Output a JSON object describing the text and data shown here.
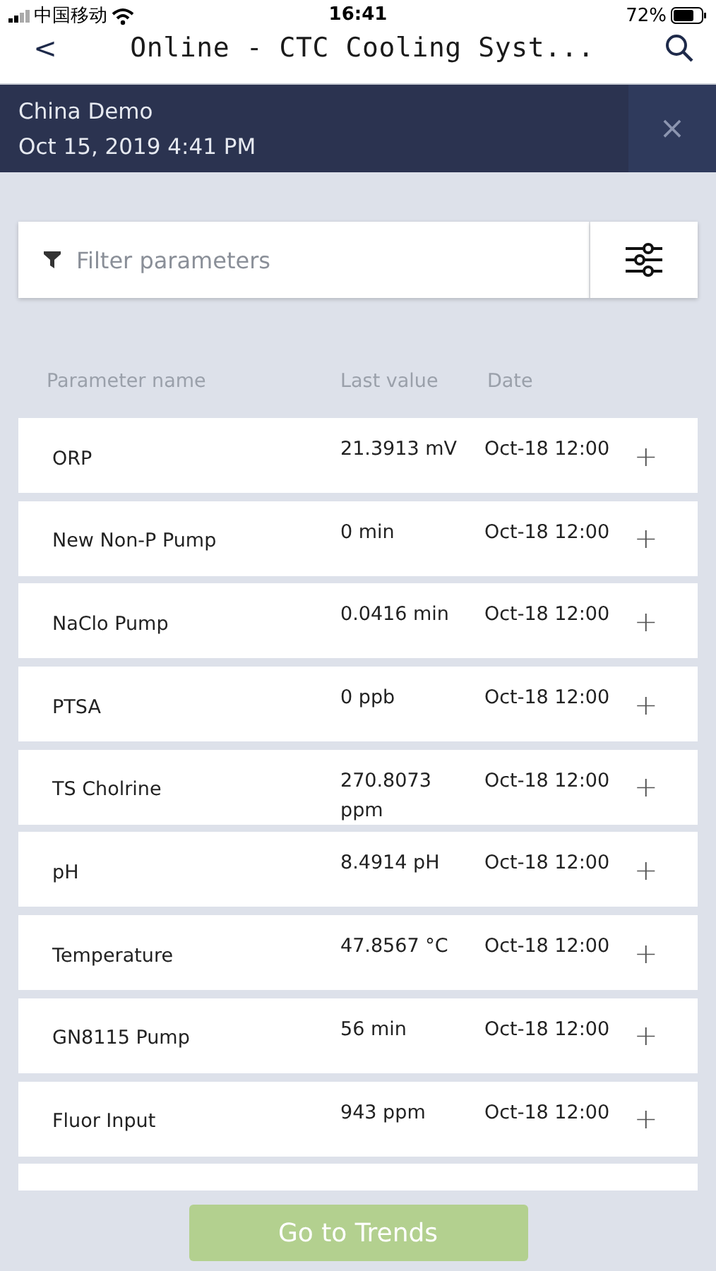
{
  "status_bar": {
    "carrier": "中国移动",
    "time": "16:41",
    "battery": "72%"
  },
  "nav": {
    "back": "<",
    "title": "Online - CTC Cooling Syst..."
  },
  "banner": {
    "site": "China Demo",
    "datetime": "Oct 15, 2019 4:41 PM",
    "close": "×"
  },
  "filter": {
    "placeholder": "Filter parameters"
  },
  "table": {
    "columns": [
      "Parameter name",
      "Last value",
      "Date"
    ],
    "rows": [
      {
        "name": "ORP",
        "value": "21.3913 mV",
        "date": "Oct-18 12:00",
        "action": "+"
      },
      {
        "name": "New Non-P Pump",
        "value": "0 min",
        "date": "Oct-18 12:00",
        "action": "+"
      },
      {
        "name": "NaClo Pump",
        "value": "0.0416 min",
        "date": "Oct-18 12:00",
        "action": "+"
      },
      {
        "name": "PTSA",
        "value": "0 ppb",
        "date": "Oct-18 12:00",
        "action": "+"
      },
      {
        "name": "TS Cholrine",
        "value": "270.8073 ppm",
        "date": "Oct-18 12:00",
        "action": "+"
      },
      {
        "name": "pH",
        "value": "8.4914 pH",
        "date": "Oct-18 12:00",
        "action": "+"
      },
      {
        "name": "Temperature",
        "value": "47.8567 °C",
        "date": "Oct-18 12:00",
        "action": "+"
      },
      {
        "name": "GN8115 Pump",
        "value": "56 min",
        "date": "Oct-18 12:00",
        "action": "+"
      },
      {
        "name": "Fluor Input",
        "value": "943 ppm",
        "date": "Oct-18 12:00",
        "action": "+"
      }
    ]
  },
  "trends_button": {
    "label": "Go to Trends",
    "disabled": true
  }
}
